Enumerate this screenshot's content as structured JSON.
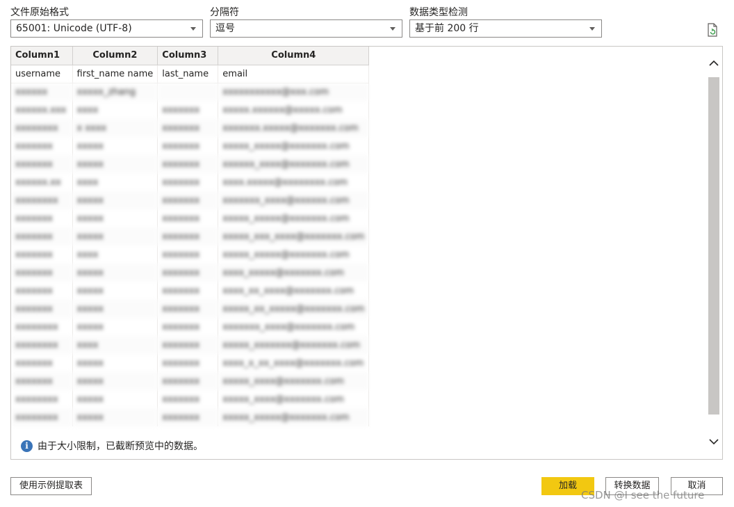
{
  "options": {
    "file_origin": {
      "label": "文件原始格式",
      "value": "65001: Unicode (UTF-8)"
    },
    "delimiter": {
      "label": "分隔符",
      "value": "逗号"
    },
    "type_detection": {
      "label": "数据类型检测",
      "value": "基于前 200 行"
    }
  },
  "icons": {
    "refresh": "refresh-icon",
    "info": "info-icon",
    "scroll_up": "chevron-up-icon",
    "scroll_down": "chevron-down-icon"
  },
  "table": {
    "headers": [
      "Column1",
      "Column2",
      "Column3",
      "Column4"
    ],
    "first_row": [
      "username",
      "first_name name",
      "last_name",
      "email"
    ],
    "blurred_rows": [
      [
        "xxxxxx",
        "xxxxx_zhang",
        "",
        "xxxxxxxxxxx@xxx.com"
      ],
      [
        "xxxxxx.xxx",
        "xxxx",
        "xxxxxxx",
        "xxxxx.xxxxxx@xxxxx.com"
      ],
      [
        "xxxxxxxx",
        "x xxxx",
        "xxxxxxx",
        "xxxxxxx.xxxxx@xxxxxxx.com"
      ],
      [
        "xxxxxxx",
        "xxxxx",
        "xxxxxxx",
        "xxxxx_xxxxx@xxxxxxx.com"
      ],
      [
        "xxxxxxx",
        "xxxxx",
        "xxxxxxx",
        "xxxxxx_xxxx@xxxxxxx.com"
      ],
      [
        "xxxxxx.xx",
        "xxxx",
        "xxxxxxx",
        "xxxx.xxxxx@xxxxxxxx.com"
      ],
      [
        "xxxxxxxx",
        "xxxxx",
        "xxxxxxx",
        "xxxxxxx_xxxx@xxxxxx.com"
      ],
      [
        "xxxxxxx",
        "xxxxx",
        "xxxxxxx",
        "xxxxx_xxxxx@xxxxxxx.com"
      ],
      [
        "xxxxxxx",
        "xxxxx",
        "xxxxxxx",
        "xxxxx_xxx_xxxx@xxxxxxx.com"
      ],
      [
        "xxxxxxx",
        "xxxx",
        "xxxxxxx",
        "xxxxx_xxxxx@xxxxxxx.com"
      ],
      [
        "xxxxxxx",
        "xxxxx",
        "xxxxxxx",
        "xxxx_xxxxx@xxxxxxx.com"
      ],
      [
        "xxxxxxx",
        "xxxxx",
        "xxxxxxx",
        "xxxx_xx_xxxx@xxxxxxx.com"
      ],
      [
        "xxxxxxx",
        "xxxxx",
        "xxxxxxx",
        "xxxxx_xx_xxxxx@xxxxxxx.com"
      ],
      [
        "xxxxxxxx",
        "xxxxx",
        "xxxxxxx",
        "xxxxxxx_xxxx@xxxxxxx.com"
      ],
      [
        "xxxxxxxx",
        "xxxx",
        "xxxxxxx",
        "xxxxx_xxxxxxx@xxxxxxx.com"
      ],
      [
        "xxxxxxx",
        "xxxxx",
        "xxxxxxx",
        "xxxx_x_xx_xxxx@xxxxxxx.com"
      ],
      [
        "xxxxxxx",
        "xxxxx",
        "xxxxxxx",
        "xxxxx_xxxx@xxxxxxx.com"
      ],
      [
        "xxxxxxxx",
        "xxxxx",
        "xxxxxxx",
        "xxxxx_xxxx@xxxxxxx.com"
      ],
      [
        "xxxxxxxx",
        "xxxxx",
        "xxxxxxx",
        "xxxxx_xxxxx@xxxxxxx.com"
      ]
    ]
  },
  "info_message": "由于大小限制，已截断预览中的数据。",
  "buttons": {
    "extract_by_example": "使用示例提取表",
    "load": "加载",
    "transform": "转换数据",
    "cancel": "取消"
  },
  "watermark": "CSDN @I see the future"
}
